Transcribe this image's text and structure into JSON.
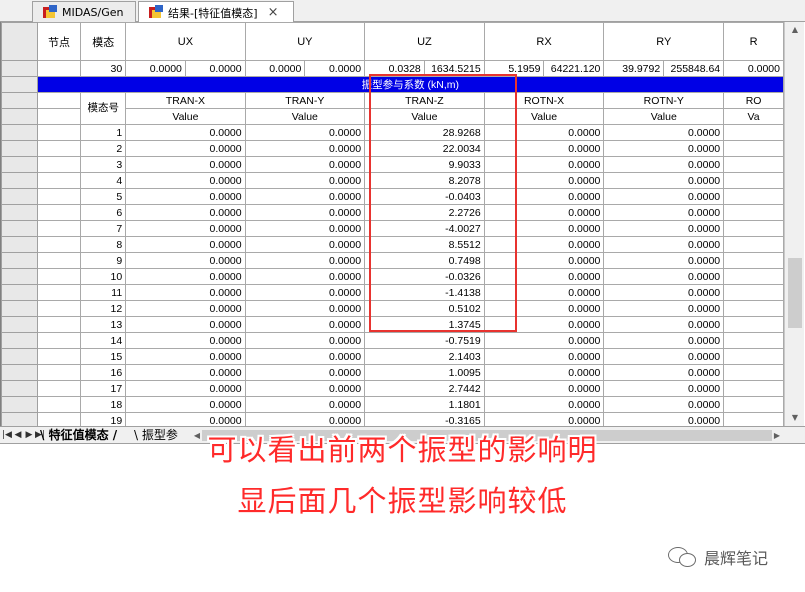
{
  "tabs": [
    {
      "label": "MIDAS/Gen",
      "icon": "midas-app-icon",
      "active": false
    },
    {
      "label": "结果-[特征值模态]",
      "icon": "midas-app-icon",
      "active": true,
      "close": "×"
    }
  ],
  "grid": {
    "header": {
      "node": "节点",
      "mode": "模态",
      "ux": "UX",
      "uy": "UY",
      "uz": "UZ",
      "rx": "RX",
      "ry": "RY",
      "rz_partial": "R"
    },
    "summary_row": {
      "mode": "30",
      "values": [
        "0.0000",
        "0.0000",
        "0.0000",
        "0.0000",
        "0.0328",
        "1634.5215",
        "5.1959",
        "64221.120",
        "39.9792",
        "255848.64",
        "0.0000"
      ]
    },
    "section_title": "振型参与系数 (kN,m)",
    "sub_header": {
      "mode_label": "模态号",
      "tran_x": "TRAN-X",
      "tran_y": "TRAN-Y",
      "tran_z": "TRAN-Z",
      "rotn_x": "ROTN-X",
      "rotn_y": "ROTN-Y",
      "rotn_z_partial": "RO",
      "value": "Value",
      "value_partial": "Va"
    },
    "rows": [
      {
        "mode": "1",
        "tran_x": "0.0000",
        "tran_y": "0.0000",
        "tran_z": "28.9268",
        "rotn_x": "0.0000",
        "rotn_y": "0.0000"
      },
      {
        "mode": "2",
        "tran_x": "0.0000",
        "tran_y": "0.0000",
        "tran_z": "22.0034",
        "rotn_x": "0.0000",
        "rotn_y": "0.0000"
      },
      {
        "mode": "3",
        "tran_x": "0.0000",
        "tran_y": "0.0000",
        "tran_z": "9.9033",
        "rotn_x": "0.0000",
        "rotn_y": "0.0000"
      },
      {
        "mode": "4",
        "tran_x": "0.0000",
        "tran_y": "0.0000",
        "tran_z": "8.2078",
        "rotn_x": "0.0000",
        "rotn_y": "0.0000"
      },
      {
        "mode": "5",
        "tran_x": "0.0000",
        "tran_y": "0.0000",
        "tran_z": "-0.0403",
        "rotn_x": "0.0000",
        "rotn_y": "0.0000"
      },
      {
        "mode": "6",
        "tran_x": "0.0000",
        "tran_y": "0.0000",
        "tran_z": "2.2726",
        "rotn_x": "0.0000",
        "rotn_y": "0.0000"
      },
      {
        "mode": "7",
        "tran_x": "0.0000",
        "tran_y": "0.0000",
        "tran_z": "-4.0027",
        "rotn_x": "0.0000",
        "rotn_y": "0.0000"
      },
      {
        "mode": "8",
        "tran_x": "0.0000",
        "tran_y": "0.0000",
        "tran_z": "8.5512",
        "rotn_x": "0.0000",
        "rotn_y": "0.0000"
      },
      {
        "mode": "9",
        "tran_x": "0.0000",
        "tran_y": "0.0000",
        "tran_z": "0.7498",
        "rotn_x": "0.0000",
        "rotn_y": "0.0000"
      },
      {
        "mode": "10",
        "tran_x": "0.0000",
        "tran_y": "0.0000",
        "tran_z": "-0.0326",
        "rotn_x": "0.0000",
        "rotn_y": "0.0000"
      },
      {
        "mode": "11",
        "tran_x": "0.0000",
        "tran_y": "0.0000",
        "tran_z": "-1.4138",
        "rotn_x": "0.0000",
        "rotn_y": "0.0000"
      },
      {
        "mode": "12",
        "tran_x": "0.0000",
        "tran_y": "0.0000",
        "tran_z": "0.5102",
        "rotn_x": "0.0000",
        "rotn_y": "0.0000"
      },
      {
        "mode": "13",
        "tran_x": "0.0000",
        "tran_y": "0.0000",
        "tran_z": "1.3745",
        "rotn_x": "0.0000",
        "rotn_y": "0.0000"
      },
      {
        "mode": "14",
        "tran_x": "0.0000",
        "tran_y": "0.0000",
        "tran_z": "-0.7519",
        "rotn_x": "0.0000",
        "rotn_y": "0.0000"
      },
      {
        "mode": "15",
        "tran_x": "0.0000",
        "tran_y": "0.0000",
        "tran_z": "2.1403",
        "rotn_x": "0.0000",
        "rotn_y": "0.0000"
      },
      {
        "mode": "16",
        "tran_x": "0.0000",
        "tran_y": "0.0000",
        "tran_z": "1.0095",
        "rotn_x": "0.0000",
        "rotn_y": "0.0000"
      },
      {
        "mode": "17",
        "tran_x": "0.0000",
        "tran_y": "0.0000",
        "tran_z": "2.7442",
        "rotn_x": "0.0000",
        "rotn_y": "0.0000"
      },
      {
        "mode": "18",
        "tran_x": "0.0000",
        "tran_y": "0.0000",
        "tran_z": "1.1801",
        "rotn_x": "0.0000",
        "rotn_y": "0.0000"
      },
      {
        "mode": "19",
        "tran_x": "0.0000",
        "tran_y": "0.0000",
        "tran_z": "-0.3165",
        "rotn_x": "0.0000",
        "rotn_y": "0.0000"
      }
    ]
  },
  "sheet_tabs": [
    {
      "label": "特征值模态",
      "active": true
    },
    {
      "label": "振型参",
      "active": false
    }
  ],
  "caption": {
    "line1": "可以看出前两个振型的影响明",
    "line2": "显后面几个振型影响较低",
    "color": "#ff2a2a"
  },
  "watermark": "晨辉笔记",
  "highlight_color": "#e8332f",
  "header_band_color": "#0000e6"
}
